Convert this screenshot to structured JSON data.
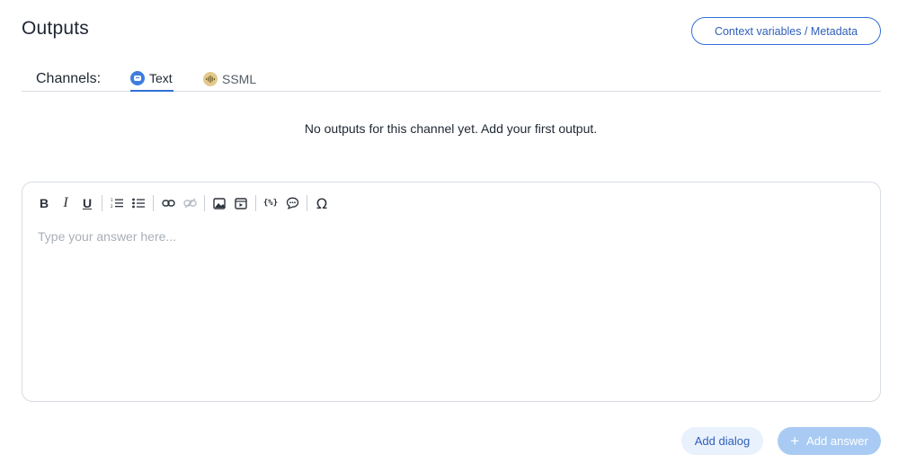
{
  "header": {
    "title": "Outputs",
    "context_button_label": "Context variables / Metadata"
  },
  "channels": {
    "label": "Channels:",
    "tabs": [
      {
        "label": "Text",
        "icon": "chat-bubble-icon",
        "active": true
      },
      {
        "label": "SSML",
        "icon": "soundwave-icon",
        "active": false
      }
    ]
  },
  "empty_state": {
    "message": "No outputs for this channel yet. Add your first output."
  },
  "editor": {
    "toolbar": [
      {
        "name": "bold",
        "glyph": "B"
      },
      {
        "name": "italic",
        "glyph": "I"
      },
      {
        "name": "underline",
        "glyph": "U"
      },
      {
        "name": "ordered-list",
        "icon": "ordered-list-icon"
      },
      {
        "name": "bullet-list",
        "icon": "bullet-list-icon"
      },
      {
        "name": "link",
        "icon": "link-icon"
      },
      {
        "name": "unlink",
        "icon": "unlink-icon",
        "disabled": true
      },
      {
        "name": "image",
        "icon": "image-icon"
      },
      {
        "name": "video",
        "icon": "video-icon"
      },
      {
        "name": "variables",
        "glyph": "{%}"
      },
      {
        "name": "quick-reply",
        "icon": "chat-dots-icon"
      },
      {
        "name": "special-char",
        "glyph": "Ω"
      }
    ],
    "placeholder": "Type your answer here..."
  },
  "footer": {
    "add_dialog_label": "Add dialog",
    "add_answer_label": "Add answer"
  },
  "colors": {
    "accent": "#2f6fd8",
    "accent_light": "#e9f1fd",
    "disabled_button": "#a9cbf3"
  }
}
